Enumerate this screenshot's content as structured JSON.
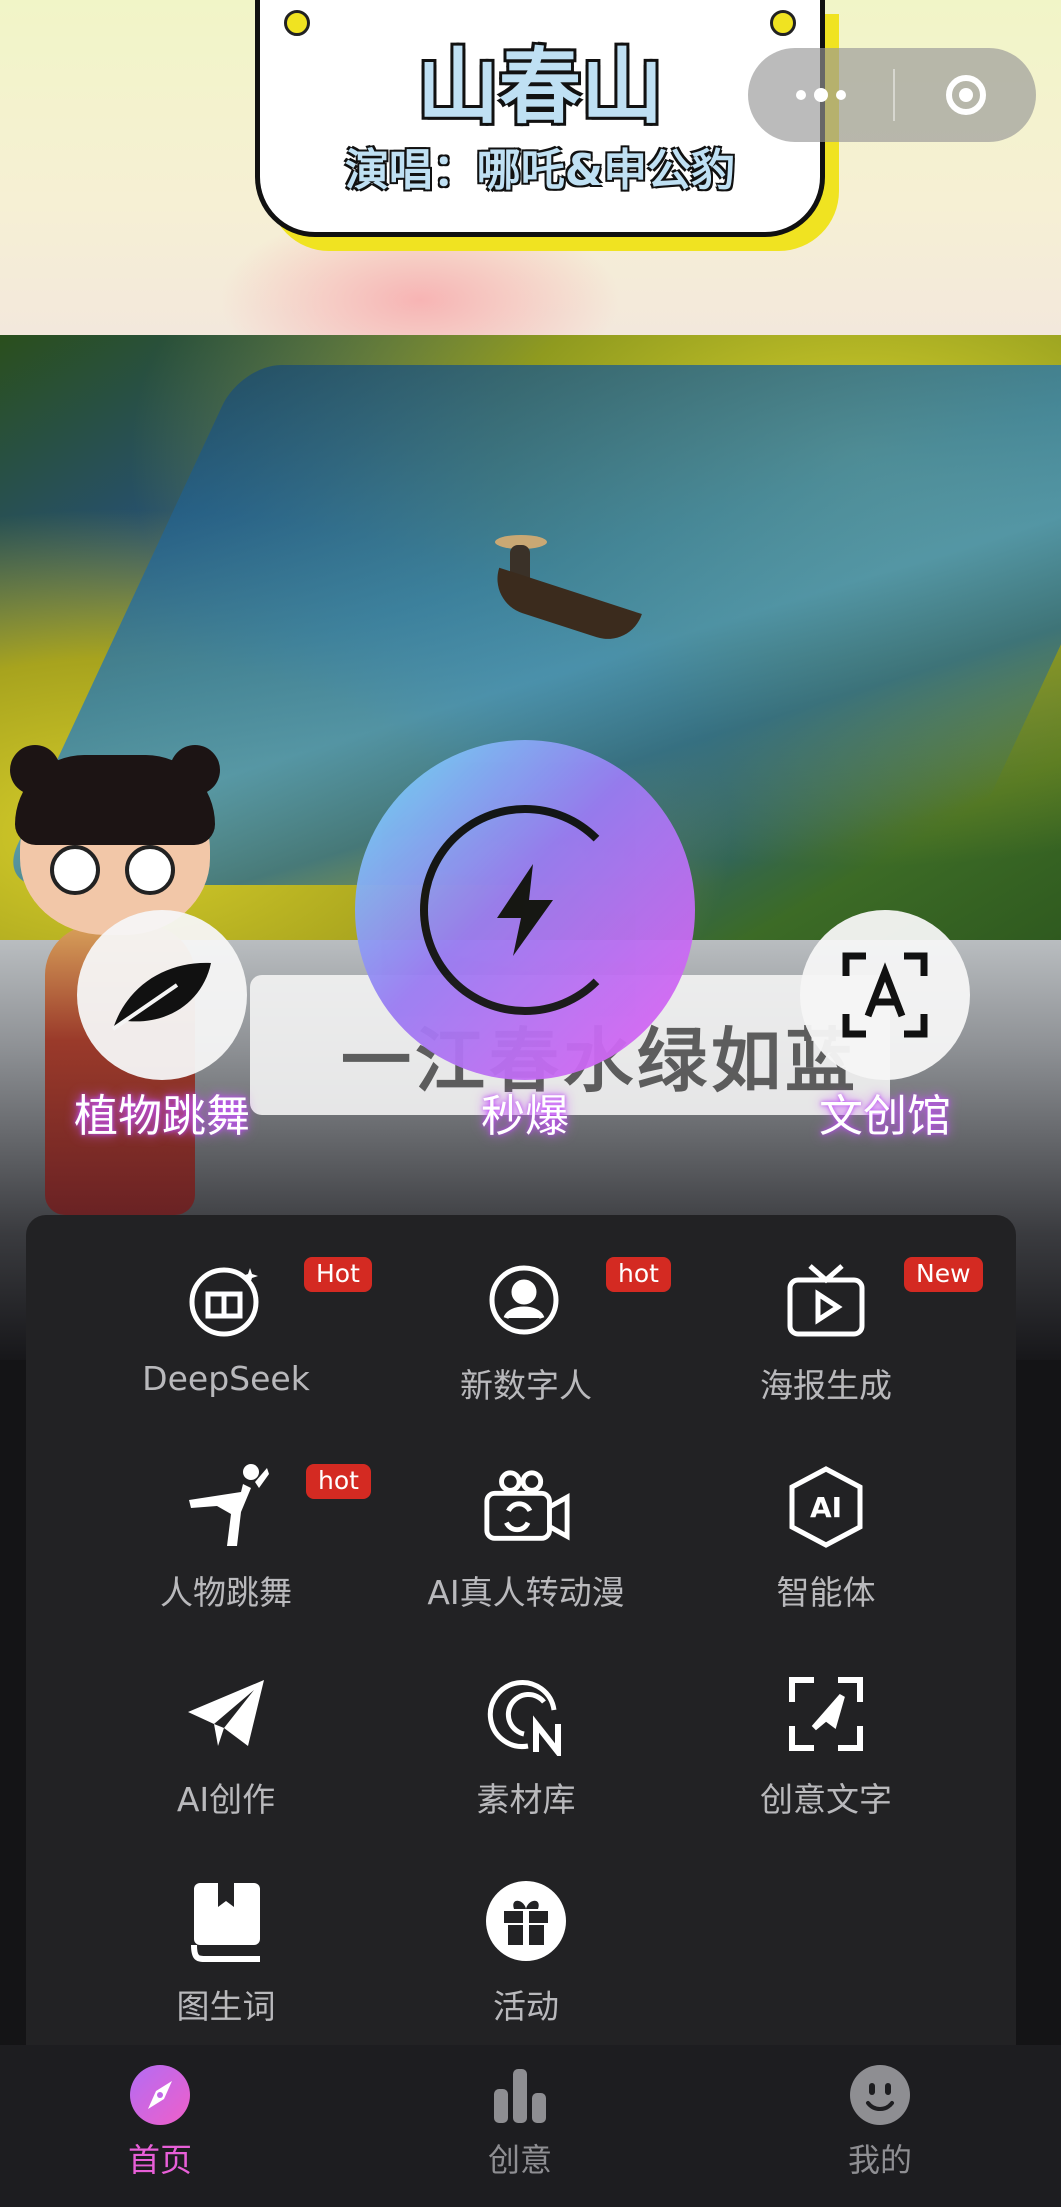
{
  "banner": {
    "title": "山春山",
    "subtitle": "演唱：哪吒&申公豹",
    "lyric": "一江春水绿如蓝"
  },
  "capsule": {
    "more_icon": "more-dots-icon",
    "close_icon": "target-circle-icon"
  },
  "quick_actions": [
    {
      "label": "植物跳舞",
      "icon": "leaf-icon"
    },
    {
      "label": "秒爆",
      "icon": "lightning-icon"
    },
    {
      "label": "文创馆",
      "icon": "text-scan-icon"
    }
  ],
  "features": [
    {
      "label": "DeepSeek",
      "badge": "Hot",
      "icon": "book-sparkle-icon"
    },
    {
      "label": "新数字人",
      "badge": "hot",
      "icon": "digital-person-icon"
    },
    {
      "label": "海报生成",
      "badge": "New",
      "icon": "tv-play-icon"
    },
    {
      "label": "人物跳舞",
      "badge": "hot",
      "icon": "dancer-icon"
    },
    {
      "label": "AI真人转动漫",
      "badge": "",
      "icon": "camera-convert-icon"
    },
    {
      "label": "智能体",
      "badge": "",
      "icon": "ai-hexagon-icon"
    },
    {
      "label": "AI创作",
      "badge": "",
      "icon": "paper-plane-icon"
    },
    {
      "label": "素材库",
      "badge": "",
      "icon": "library-n-icon"
    },
    {
      "label": "创意文字",
      "badge": "",
      "icon": "cursor-frame-icon"
    },
    {
      "label": "图生词",
      "badge": "",
      "icon": "book-icon"
    },
    {
      "label": "活动",
      "badge": "",
      "icon": "gift-icon"
    }
  ],
  "tabs": [
    {
      "label": "首页",
      "icon": "compass-icon",
      "active": true
    },
    {
      "label": "创意",
      "icon": "bar-chart-icon",
      "active": false
    },
    {
      "label": "我的",
      "icon": "smiley-icon",
      "active": false
    }
  ],
  "colors": {
    "accent": "#e85fd8",
    "badge": "#d42a22",
    "panel": "#222224"
  }
}
